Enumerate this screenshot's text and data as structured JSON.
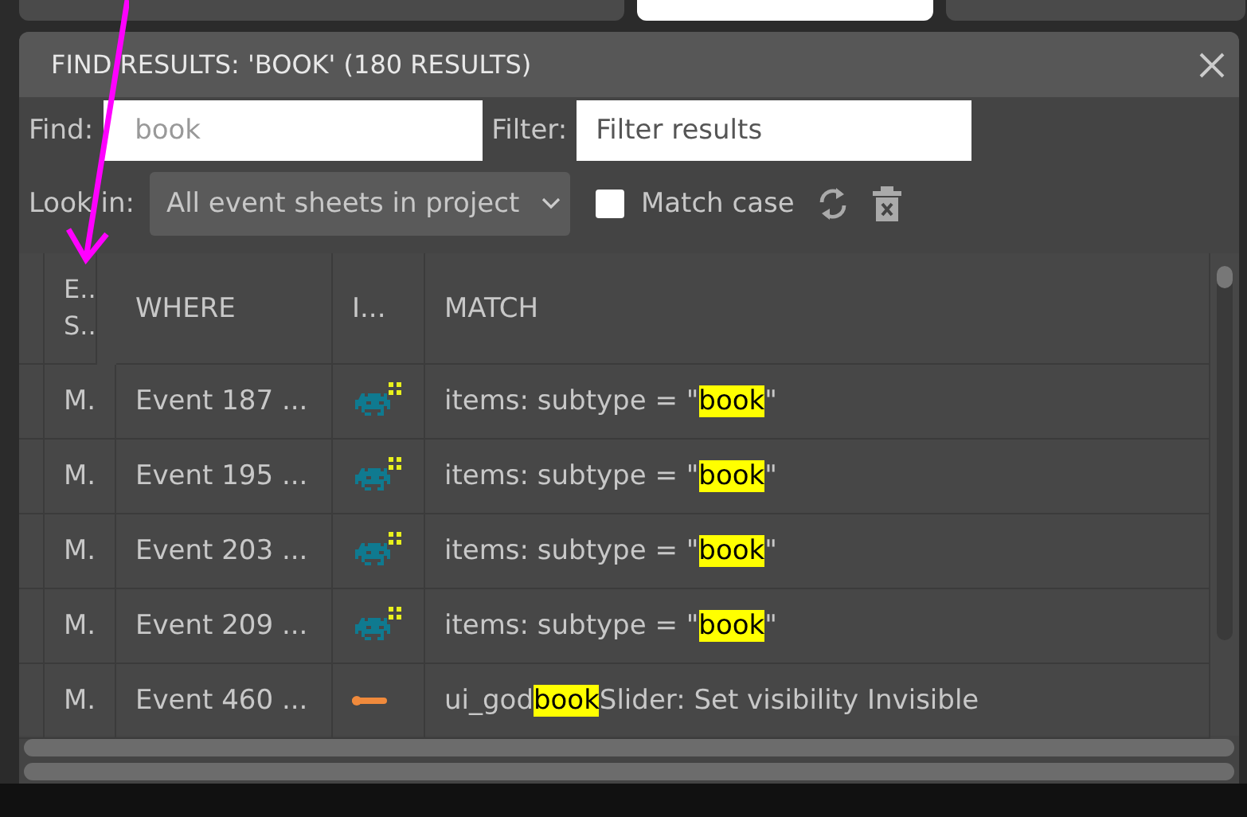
{
  "tabs": [
    {
      "selected": false
    },
    {
      "selected": true
    },
    {
      "selected": false
    }
  ],
  "panel": {
    "title": "FIND RESULTS: 'BOOK' (180 RESULTS)"
  },
  "find": {
    "label": "Find:",
    "value": "book"
  },
  "filter": {
    "label": "Filter:",
    "placeholder": "Filter results"
  },
  "look_in": {
    "label": "Look in:",
    "value": "All event sheets in project"
  },
  "match_case": {
    "label": "Match case",
    "checked": false
  },
  "table": {
    "columns": [
      "E.. S..",
      "WHERE",
      "I...",
      "MATCH"
    ],
    "rows": [
      {
        "sheet": "M.",
        "where": "Event 187 ...",
        "kind": "sprite",
        "match": [
          {
            "text": "items: subtype = \"",
            "hit": false
          },
          {
            "text": "book",
            "hit": true
          },
          {
            "text": "\"",
            "hit": false
          }
        ]
      },
      {
        "sheet": "M.",
        "where": "Event 195 ...",
        "kind": "sprite",
        "match": [
          {
            "text": "items: subtype = \"",
            "hit": false
          },
          {
            "text": "book",
            "hit": true
          },
          {
            "text": "\"",
            "hit": false
          }
        ]
      },
      {
        "sheet": "M.",
        "where": "Event 203 ...",
        "kind": "sprite",
        "match": [
          {
            "text": "items: subtype = \"",
            "hit": false
          },
          {
            "text": "book",
            "hit": true
          },
          {
            "text": "\"",
            "hit": false
          }
        ]
      },
      {
        "sheet": "M.",
        "where": "Event 209 ...",
        "kind": "sprite",
        "match": [
          {
            "text": "items: subtype = \"",
            "hit": false
          },
          {
            "text": "book",
            "hit": true
          },
          {
            "text": "\"",
            "hit": false
          }
        ]
      },
      {
        "sheet": "M.",
        "where": "Event 460 ...",
        "kind": "slider",
        "match": [
          {
            "text": "ui_god",
            "hit": false
          },
          {
            "text": "book",
            "hit": true
          },
          {
            "text": "Slider: Set visibility Invisible",
            "hit": false
          }
        ]
      }
    ]
  }
}
